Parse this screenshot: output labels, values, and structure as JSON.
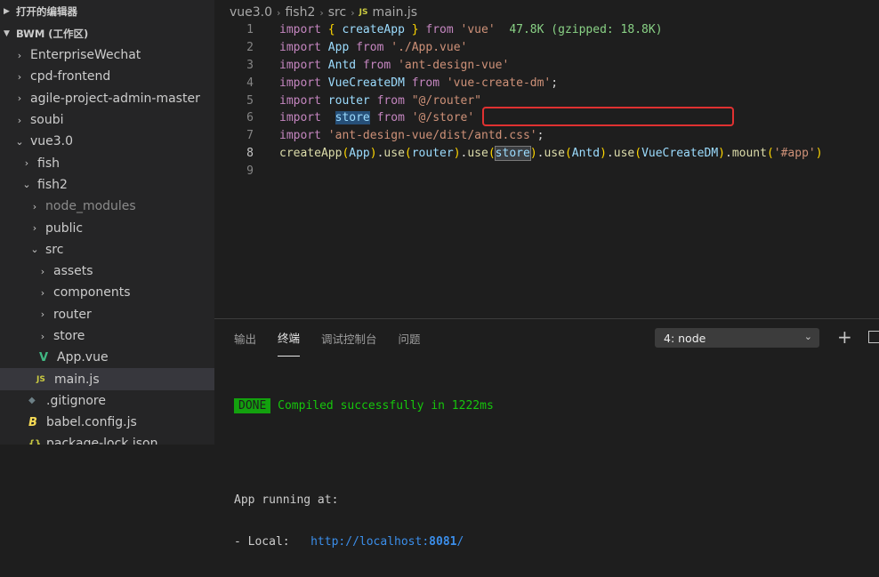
{
  "sidebar": {
    "open_editors_label": "打开的编辑器",
    "workspace_label": "BWM (工作区)",
    "items": [
      {
        "label": "EnterpriseWechat"
      },
      {
        "label": "cpd-frontend"
      },
      {
        "label": "agile-project-admin-master"
      },
      {
        "label": "soubi"
      },
      {
        "label": "vue3.0"
      },
      {
        "label": "fish"
      },
      {
        "label": "fish2"
      },
      {
        "label": "node_modules"
      },
      {
        "label": "public"
      },
      {
        "label": "src"
      },
      {
        "label": "assets"
      },
      {
        "label": "components"
      },
      {
        "label": "router"
      },
      {
        "label": "store"
      },
      {
        "label": "App.vue"
      },
      {
        "label": "main.js"
      },
      {
        "label": ".gitignore"
      },
      {
        "label": "babel.config.js"
      },
      {
        "label": "package-lock.json"
      }
    ],
    "icons": {
      "vue": "V",
      "js": "JS",
      "git": "◆",
      "babel": "B",
      "json": "{}"
    }
  },
  "breadcrumb": {
    "parts": [
      "vue3.0",
      "fish2",
      "src",
      "main.js"
    ],
    "file_icon": "JS"
  },
  "code": {
    "line_numbers": [
      "1",
      "2",
      "3",
      "4",
      "5",
      "6",
      "7",
      "8",
      "9"
    ],
    "tokens": {
      "import": "import",
      "from": "from",
      "createApp": "createApp",
      "App": "App",
      "Antd": "Antd",
      "VueCreateDM": "VueCreateDM",
      "router": "router",
      "store": "store",
      "use": "use",
      "mount": "mount",
      "s_vue": "'vue'",
      "s_appvue": "'./App.vue'",
      "s_antd": "'ant-design-vue'",
      "s_dm": "'vue-create-dm'",
      "s_router": "\"@/router\"",
      "s_store": "'@/store'",
      "s_css": "'ant-design-vue/dist/antd.css'",
      "s_app": "'#app'",
      "size_hint": "47.8K (gzipped: 18.8K)"
    }
  },
  "panel": {
    "tabs": [
      "输出",
      "终端",
      "调试控制台",
      "问题"
    ],
    "terminal_select": "4: node",
    "terminal": {
      "done_badge": "DONE",
      "compiled": "Compiled successfully in 1222ms",
      "app_running": "App running at:",
      "local_label": "- Local:",
      "local_url": "http://localhost:",
      "local_port": "8081",
      "local_slash": "/"
    }
  }
}
